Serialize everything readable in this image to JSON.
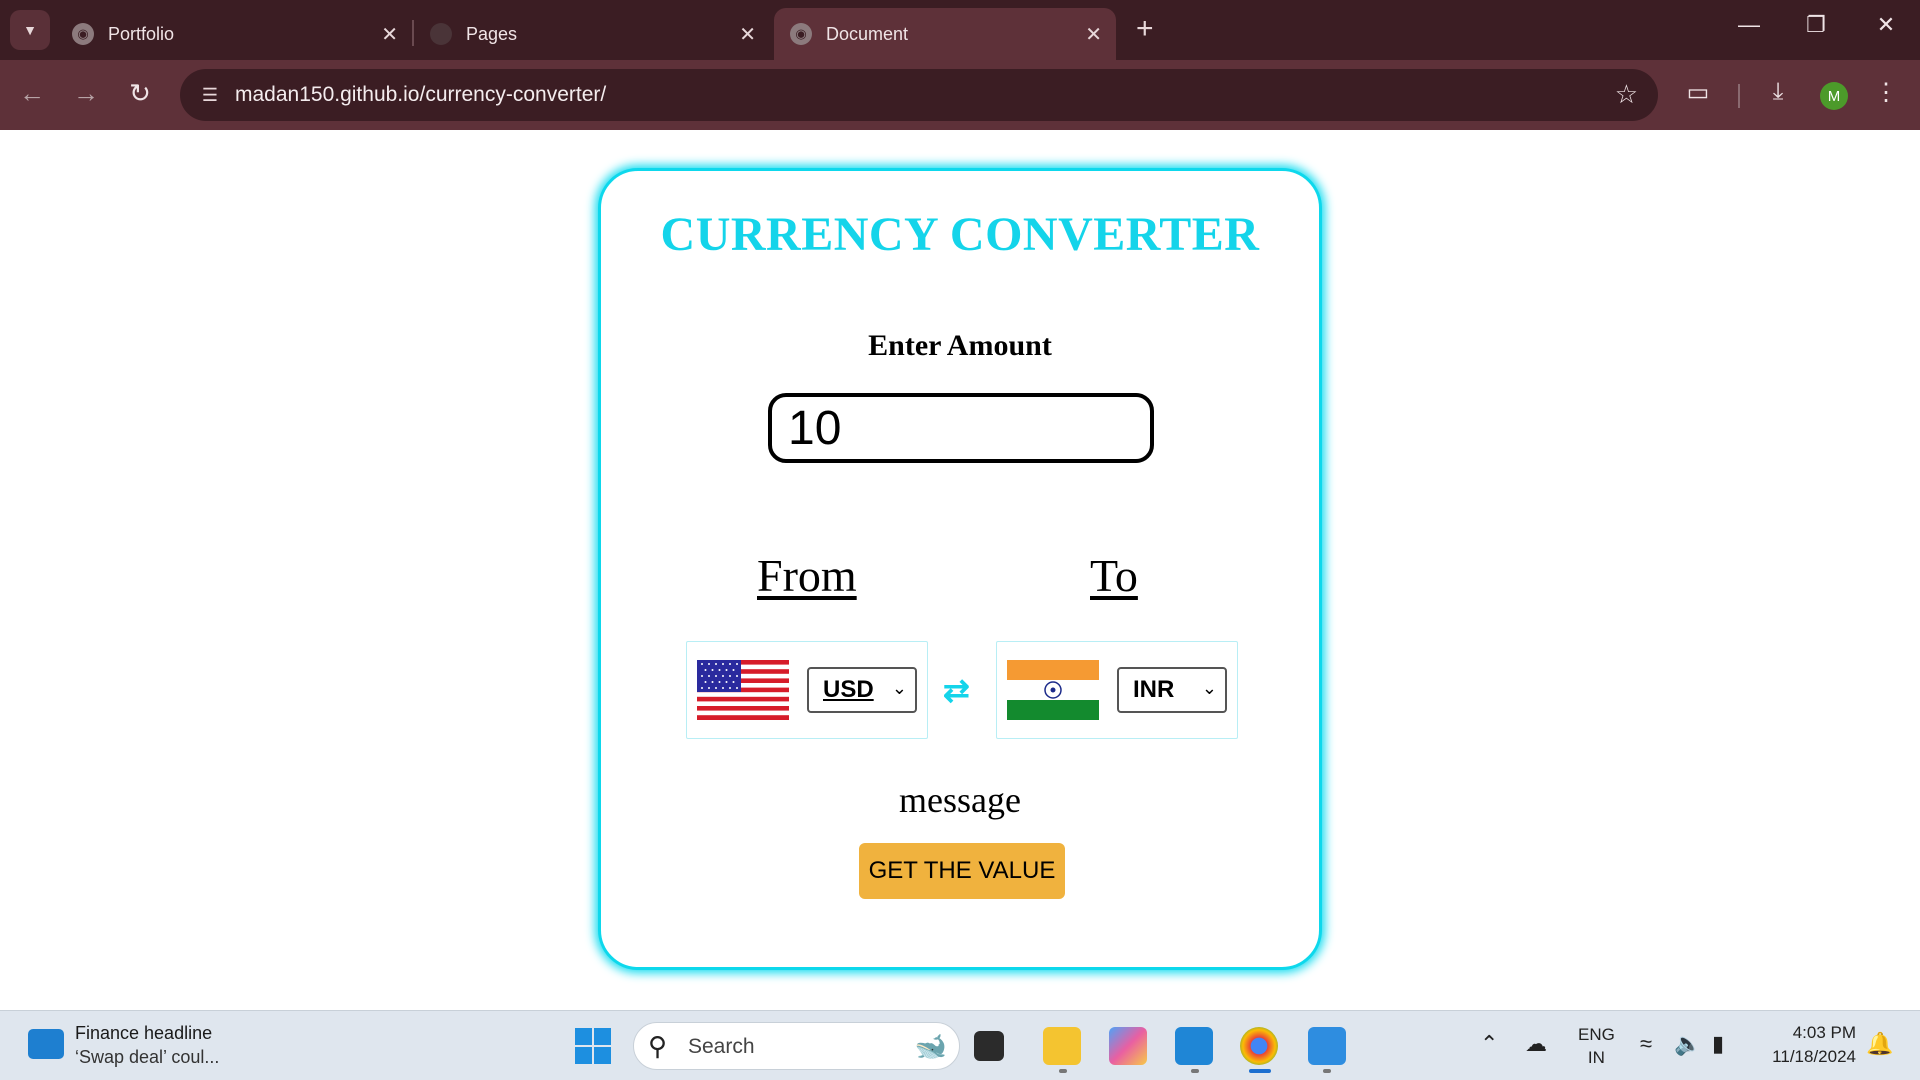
{
  "browser": {
    "tabs": [
      {
        "label": "Portfolio"
      },
      {
        "label": "Pages"
      },
      {
        "label": "Document"
      }
    ],
    "active_tab": 2,
    "url": "madan150.github.io/currency-converter/",
    "profile_initial": "M"
  },
  "app": {
    "title": "CURRENCY CONVERTER",
    "amount_label": "Enter Amount",
    "amount_value": "10",
    "from_label": "From",
    "to_label": "To",
    "from_currency": "USD",
    "to_currency": "INR",
    "message": "message",
    "button_label": "GET THE VALUE",
    "accent_color": "#14d4ea",
    "button_color": "#f0b23e"
  },
  "taskbar": {
    "news_title": "Finance headline",
    "news_subtitle": "‘Swap deal’ coul...",
    "search_placeholder": "Search",
    "language_line1": "ENG",
    "language_line2": "IN",
    "time": "4:03 PM",
    "date": "11/18/2024"
  }
}
